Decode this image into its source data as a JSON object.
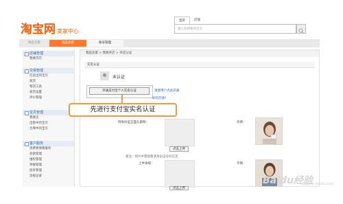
{
  "header": {
    "logo_main": "淘宝网",
    "logo_sub": "卖家中心",
    "search_tabs": [
      "宝贝",
      "店铺"
    ],
    "search_placeholder": "输入你想要的宝贝"
  },
  "navbar": {
    "tabs": [
      "我是买家",
      "我是卖家",
      "账号管理"
    ]
  },
  "sidebar": {
    "sections": [
      {
        "title": "店铺管理",
        "items": [
          "我要开店"
        ]
      },
      {
        "title": "交易管理",
        "items": [
          "已卖出的宝贝",
          "发货",
          "物流工具",
          "发货设置",
          "评价管理"
        ]
      },
      {
        "title": "宝贝管理",
        "items": [
          "我要卖",
          "出售中的宝贝",
          "仓库中的宝贝"
        ]
      },
      {
        "title": "客户服务",
        "items": [
          "消费者保障服务",
          "退款管理",
          "维权管理",
          "举报管理",
          "投诉管理",
          "违规记录"
        ]
      }
    ]
  },
  "main": {
    "breadcrumb": "我是卖家 > 我要开店 > 开店认证",
    "section_title": "实名认证",
    "status_text": "未认证",
    "open_button": "开通支付宝个人实名认证",
    "tip_link": "请使用户点此开通",
    "how_link": "如何开通？",
    "callout": "先进行支付宝实名认证",
    "id_photo_label": "持身份证正面头部照：",
    "sample_label": "示例：",
    "upload_button": "点击上传",
    "remark": "备注：照片中需能看清身份证号码信息",
    "upper_body_label": "上半身照：",
    "sample_label_2": "示例：",
    "upload_button_2": "点击上传"
  },
  "watermark": {
    "text": "Baidu经验",
    "sub": "jingyan.baidu.com"
  },
  "colors": {
    "brand_orange": "#ff5a00",
    "active_tab": "#ff7a2a",
    "callout_border": "#f19a3a",
    "link": "#3366cc"
  }
}
